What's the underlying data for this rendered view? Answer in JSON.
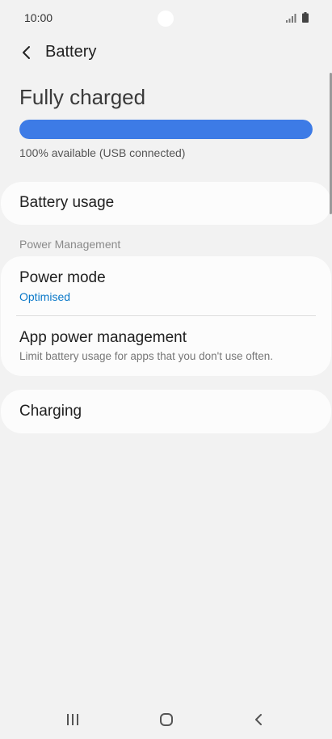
{
  "status_bar": {
    "time": "10:00"
  },
  "app_bar": {
    "title": "Battery"
  },
  "battery": {
    "state": "Fully charged",
    "level_percent": 100,
    "status_text": "100% available (USB connected)",
    "bar_color": "#3d7be6"
  },
  "items": {
    "battery_usage": "Battery usage",
    "section_header": "Power Management",
    "power_mode_label": "Power mode",
    "power_mode_value": "Optimised",
    "app_power_label": "App power management",
    "app_power_desc": "Limit battery usage for apps that you don't use often.",
    "charging_label": "Charging"
  },
  "colors": {
    "accent": "#0a78c8",
    "background": "#f2f2f2"
  },
  "icons": {
    "back": "chevron-left-icon",
    "signal": "signal-icon",
    "battery": "battery-icon",
    "recents": "recents-icon",
    "home": "home-icon",
    "nav_back": "back-icon"
  }
}
